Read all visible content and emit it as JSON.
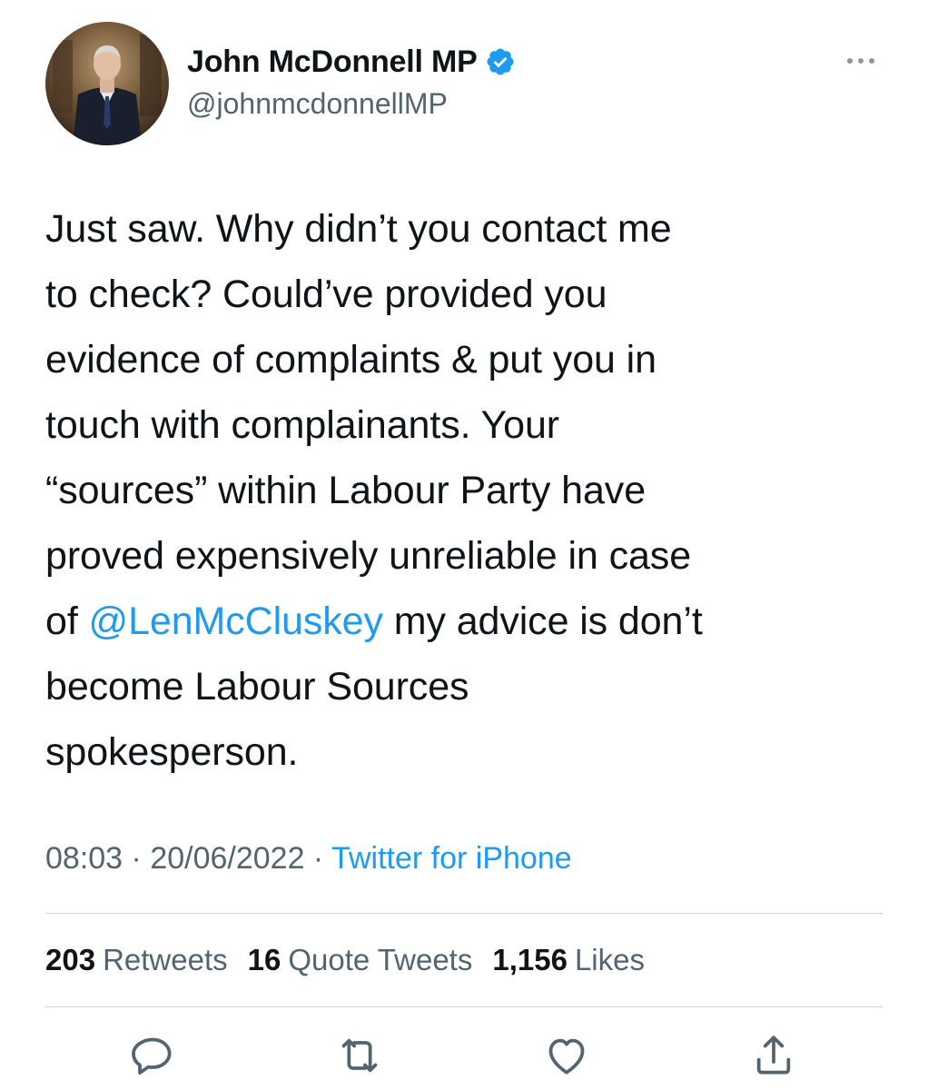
{
  "header": {
    "display_name": "John McDonnell MP",
    "handle": "@johnmcdonnellMP",
    "verified_icon": "verified-badge-icon",
    "more_icon": "more-horizontal-icon"
  },
  "tweet": {
    "lines": [
      "Just saw. Why didn’t you contact me",
      "to check? Could’ve provided you",
      "evidence of complaints & put you in",
      "touch with complainants. Your",
      "“sources” within Labour Party have",
      "proved expensively unreliable in case"
    ],
    "line7_prefix": "of ",
    "mention": "@LenMcCluskey",
    "line7_suffix": " my advice is don’t",
    "line8": "become Labour Sources",
    "line9": "spokesperson."
  },
  "meta": {
    "time": "08:03",
    "separator": " · ",
    "date": "20/06/2022",
    "source": "Twitter for iPhone"
  },
  "stats": {
    "retweets_count": "203",
    "retweets_label": "Retweets",
    "quotes_count": "16",
    "quotes_label": "Quote Tweets",
    "likes_count": "1,156",
    "likes_label": "Likes"
  },
  "actions": [
    {
      "icon": "reply-icon"
    },
    {
      "icon": "retweet-icon"
    },
    {
      "icon": "like-icon"
    },
    {
      "icon": "share-icon"
    }
  ],
  "colors": {
    "text": "#0f1419",
    "secondary": "#536471",
    "accent": "#1d9bf0",
    "divider": "#cfd9de"
  }
}
